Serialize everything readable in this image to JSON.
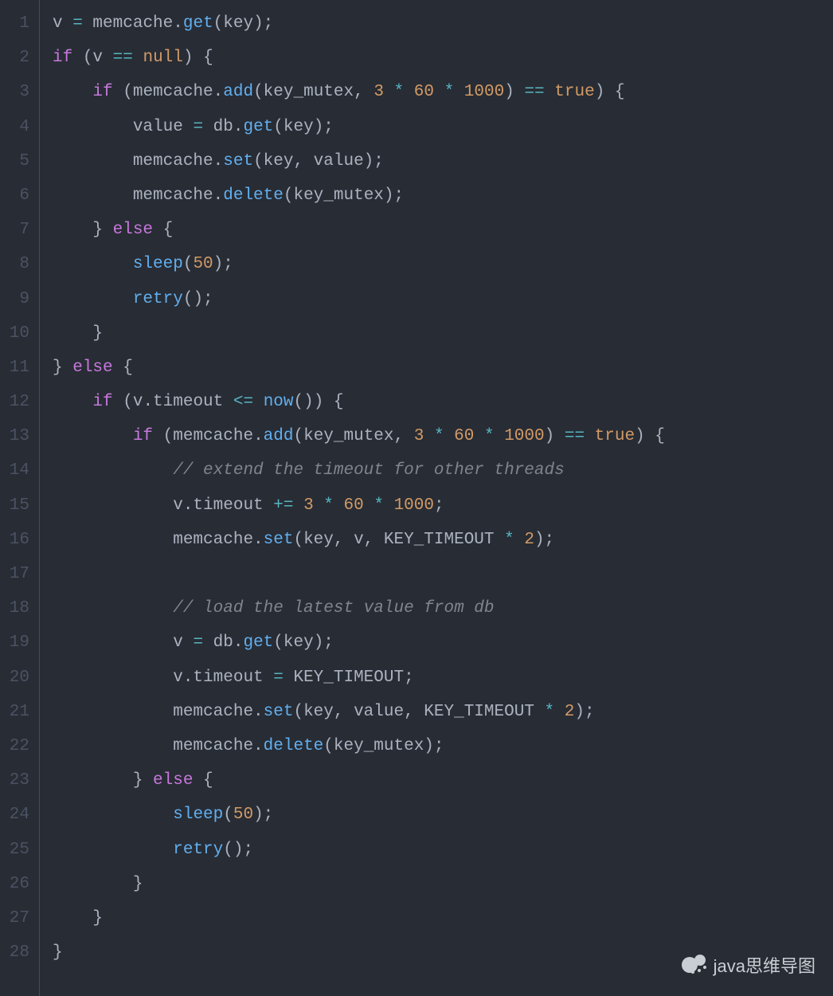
{
  "watermark": "java思维导图",
  "lines": [
    {
      "num": "1",
      "tokens": [
        {
          "t": "v ",
          "c": "id"
        },
        {
          "t": "=",
          "c": "op"
        },
        {
          "t": " memcache.",
          "c": "id"
        },
        {
          "t": "get",
          "c": "fn"
        },
        {
          "t": "(key);",
          "c": "id"
        }
      ]
    },
    {
      "num": "2",
      "tokens": [
        {
          "t": "if",
          "c": "kw"
        },
        {
          "t": " (v ",
          "c": "id"
        },
        {
          "t": "==",
          "c": "op"
        },
        {
          "t": " ",
          "c": "id"
        },
        {
          "t": "null",
          "c": "num"
        },
        {
          "t": ") {",
          "c": "id"
        }
      ]
    },
    {
      "num": "3",
      "tokens": [
        {
          "t": "    ",
          "c": "id"
        },
        {
          "t": "if",
          "c": "kw"
        },
        {
          "t": " (memcache.",
          "c": "id"
        },
        {
          "t": "add",
          "c": "fn"
        },
        {
          "t": "(key_mutex, ",
          "c": "id"
        },
        {
          "t": "3",
          "c": "num"
        },
        {
          "t": " ",
          "c": "id"
        },
        {
          "t": "*",
          "c": "op"
        },
        {
          "t": " ",
          "c": "id"
        },
        {
          "t": "60",
          "c": "num"
        },
        {
          "t": " ",
          "c": "id"
        },
        {
          "t": "*",
          "c": "op"
        },
        {
          "t": " ",
          "c": "id"
        },
        {
          "t": "1000",
          "c": "num"
        },
        {
          "t": ") ",
          "c": "id"
        },
        {
          "t": "==",
          "c": "op"
        },
        {
          "t": " ",
          "c": "id"
        },
        {
          "t": "true",
          "c": "num"
        },
        {
          "t": ") {",
          "c": "id"
        }
      ]
    },
    {
      "num": "4",
      "tokens": [
        {
          "t": "        value ",
          "c": "id"
        },
        {
          "t": "=",
          "c": "op"
        },
        {
          "t": " db.",
          "c": "id"
        },
        {
          "t": "get",
          "c": "fn"
        },
        {
          "t": "(key);",
          "c": "id"
        }
      ]
    },
    {
      "num": "5",
      "tokens": [
        {
          "t": "        memcache.",
          "c": "id"
        },
        {
          "t": "set",
          "c": "fn"
        },
        {
          "t": "(key, value);",
          "c": "id"
        }
      ]
    },
    {
      "num": "6",
      "tokens": [
        {
          "t": "        memcache.",
          "c": "id"
        },
        {
          "t": "delete",
          "c": "fn"
        },
        {
          "t": "(key_mutex);",
          "c": "id"
        }
      ]
    },
    {
      "num": "7",
      "tokens": [
        {
          "t": "    } ",
          "c": "id"
        },
        {
          "t": "else",
          "c": "kw"
        },
        {
          "t": " {",
          "c": "id"
        }
      ]
    },
    {
      "num": "8",
      "tokens": [
        {
          "t": "        ",
          "c": "id"
        },
        {
          "t": "sleep",
          "c": "fn"
        },
        {
          "t": "(",
          "c": "id"
        },
        {
          "t": "50",
          "c": "num"
        },
        {
          "t": ");",
          "c": "id"
        }
      ]
    },
    {
      "num": "9",
      "tokens": [
        {
          "t": "        ",
          "c": "id"
        },
        {
          "t": "retry",
          "c": "fn"
        },
        {
          "t": "();",
          "c": "id"
        }
      ]
    },
    {
      "num": "10",
      "tokens": [
        {
          "t": "    }",
          "c": "id"
        }
      ]
    },
    {
      "num": "11",
      "tokens": [
        {
          "t": "} ",
          "c": "id"
        },
        {
          "t": "else",
          "c": "kw"
        },
        {
          "t": " {",
          "c": "id"
        }
      ]
    },
    {
      "num": "12",
      "tokens": [
        {
          "t": "    ",
          "c": "id"
        },
        {
          "t": "if",
          "c": "kw"
        },
        {
          "t": " (v.timeout ",
          "c": "id"
        },
        {
          "t": "<=",
          "c": "op"
        },
        {
          "t": " ",
          "c": "id"
        },
        {
          "t": "now",
          "c": "fn"
        },
        {
          "t": "()) {",
          "c": "id"
        }
      ]
    },
    {
      "num": "13",
      "tokens": [
        {
          "t": "        ",
          "c": "id"
        },
        {
          "t": "if",
          "c": "kw"
        },
        {
          "t": " (memcache.",
          "c": "id"
        },
        {
          "t": "add",
          "c": "fn"
        },
        {
          "t": "(key_mutex, ",
          "c": "id"
        },
        {
          "t": "3",
          "c": "num"
        },
        {
          "t": " ",
          "c": "id"
        },
        {
          "t": "*",
          "c": "op"
        },
        {
          "t": " ",
          "c": "id"
        },
        {
          "t": "60",
          "c": "num"
        },
        {
          "t": " ",
          "c": "id"
        },
        {
          "t": "*",
          "c": "op"
        },
        {
          "t": " ",
          "c": "id"
        },
        {
          "t": "1000",
          "c": "num"
        },
        {
          "t": ") ",
          "c": "id"
        },
        {
          "t": "==",
          "c": "op"
        },
        {
          "t": " ",
          "c": "id"
        },
        {
          "t": "true",
          "c": "num"
        },
        {
          "t": ") {",
          "c": "id"
        }
      ]
    },
    {
      "num": "14",
      "tokens": [
        {
          "t": "            ",
          "c": "id"
        },
        {
          "t": "// extend the timeout for other threads",
          "c": "comment"
        }
      ]
    },
    {
      "num": "15",
      "tokens": [
        {
          "t": "            v.timeout ",
          "c": "id"
        },
        {
          "t": "+=",
          "c": "op"
        },
        {
          "t": " ",
          "c": "id"
        },
        {
          "t": "3",
          "c": "num"
        },
        {
          "t": " ",
          "c": "id"
        },
        {
          "t": "*",
          "c": "op"
        },
        {
          "t": " ",
          "c": "id"
        },
        {
          "t": "60",
          "c": "num"
        },
        {
          "t": " ",
          "c": "id"
        },
        {
          "t": "*",
          "c": "op"
        },
        {
          "t": " ",
          "c": "id"
        },
        {
          "t": "1000",
          "c": "num"
        },
        {
          "t": ";",
          "c": "id"
        }
      ]
    },
    {
      "num": "16",
      "tokens": [
        {
          "t": "            memcache.",
          "c": "id"
        },
        {
          "t": "set",
          "c": "fn"
        },
        {
          "t": "(key, v, KEY_TIMEOUT ",
          "c": "id"
        },
        {
          "t": "*",
          "c": "op"
        },
        {
          "t": " ",
          "c": "id"
        },
        {
          "t": "2",
          "c": "num"
        },
        {
          "t": ");",
          "c": "id"
        }
      ]
    },
    {
      "num": "17",
      "tokens": [
        {
          "t": "",
          "c": "id"
        }
      ]
    },
    {
      "num": "18",
      "tokens": [
        {
          "t": "            ",
          "c": "id"
        },
        {
          "t": "// load the latest value from db",
          "c": "comment"
        }
      ]
    },
    {
      "num": "19",
      "tokens": [
        {
          "t": "            v ",
          "c": "id"
        },
        {
          "t": "=",
          "c": "op"
        },
        {
          "t": " db.",
          "c": "id"
        },
        {
          "t": "get",
          "c": "fn"
        },
        {
          "t": "(key);",
          "c": "id"
        }
      ]
    },
    {
      "num": "20",
      "tokens": [
        {
          "t": "            v.timeout ",
          "c": "id"
        },
        {
          "t": "=",
          "c": "op"
        },
        {
          "t": " KEY_TIMEOUT;",
          "c": "id"
        }
      ]
    },
    {
      "num": "21",
      "tokens": [
        {
          "t": "            memcache.",
          "c": "id"
        },
        {
          "t": "set",
          "c": "fn"
        },
        {
          "t": "(key, value, KEY_TIMEOUT ",
          "c": "id"
        },
        {
          "t": "*",
          "c": "op"
        },
        {
          "t": " ",
          "c": "id"
        },
        {
          "t": "2",
          "c": "num"
        },
        {
          "t": ");",
          "c": "id"
        }
      ]
    },
    {
      "num": "22",
      "tokens": [
        {
          "t": "            memcache.",
          "c": "id"
        },
        {
          "t": "delete",
          "c": "fn"
        },
        {
          "t": "(key_mutex);",
          "c": "id"
        }
      ]
    },
    {
      "num": "23",
      "tokens": [
        {
          "t": "        } ",
          "c": "id"
        },
        {
          "t": "else",
          "c": "kw"
        },
        {
          "t": " {",
          "c": "id"
        }
      ]
    },
    {
      "num": "24",
      "tokens": [
        {
          "t": "            ",
          "c": "id"
        },
        {
          "t": "sleep",
          "c": "fn"
        },
        {
          "t": "(",
          "c": "id"
        },
        {
          "t": "50",
          "c": "num"
        },
        {
          "t": ");",
          "c": "id"
        }
      ]
    },
    {
      "num": "25",
      "tokens": [
        {
          "t": "            ",
          "c": "id"
        },
        {
          "t": "retry",
          "c": "fn"
        },
        {
          "t": "();",
          "c": "id"
        }
      ]
    },
    {
      "num": "26",
      "tokens": [
        {
          "t": "        }",
          "c": "id"
        }
      ]
    },
    {
      "num": "27",
      "tokens": [
        {
          "t": "    }",
          "c": "id"
        }
      ]
    },
    {
      "num": "28",
      "tokens": [
        {
          "t": "}",
          "c": "id"
        }
      ]
    }
  ]
}
